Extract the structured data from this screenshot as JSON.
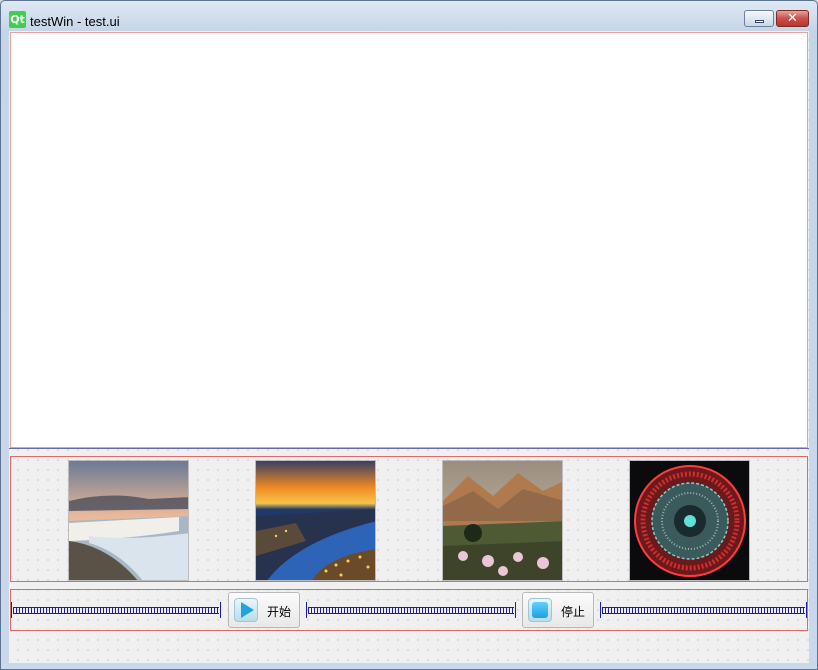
{
  "window": {
    "logo": "Qt",
    "title": "testWin - test.ui",
    "minimize_icon": "minimize-icon",
    "close_icon": "close-icon",
    "close_glyph": "✕"
  },
  "gallery": {
    "items": [
      {
        "name": "waterfall-coast"
      },
      {
        "name": "river-city-night"
      },
      {
        "name": "mountain-valley"
      },
      {
        "name": "red-ring-pattern"
      }
    ]
  },
  "controls": {
    "start_label": "开始",
    "start_icon": "play-icon",
    "stop_label": "停止",
    "stop_icon": "stop-icon"
  },
  "colors": {
    "layout_border": "#e06a6a",
    "spacer": "#1b1bb5",
    "qt_green": "#41cd52"
  }
}
